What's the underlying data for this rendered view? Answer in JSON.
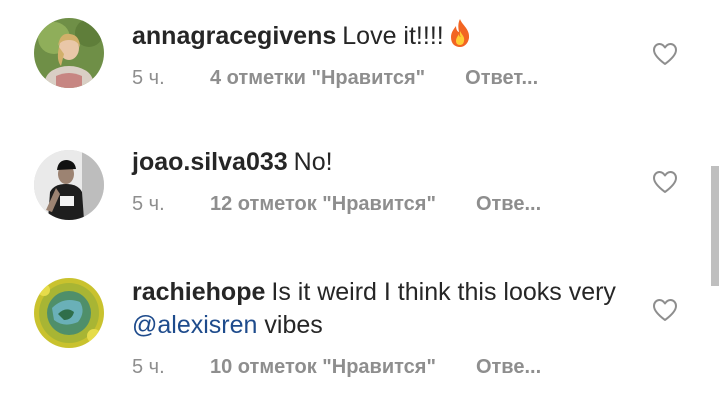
{
  "comments": [
    {
      "username": "annagracegivens",
      "text": "Love it!!!!",
      "emoji": "fire-emoji",
      "time": "5 ч.",
      "likes": "4 отметки \"Нравится\"",
      "reply": "Ответ..."
    },
    {
      "username": "joao.silva033",
      "text": "No!",
      "time": "5 ч.",
      "likes": "12 отметок \"Нравится\"",
      "reply": "Отве..."
    },
    {
      "username": "rachiehope",
      "text_before": "Is it weird I think this looks very ",
      "mention": "@alexisren",
      "text_after": " vibes",
      "time": "5 ч.",
      "likes": "10 отметок \"Нравится\"",
      "reply": "Отве..."
    }
  ],
  "icons": {
    "like": "heart-outline-icon"
  },
  "colors": {
    "text": "#262626",
    "meta": "#8e8e8e",
    "mention": "#1e4b8c"
  }
}
